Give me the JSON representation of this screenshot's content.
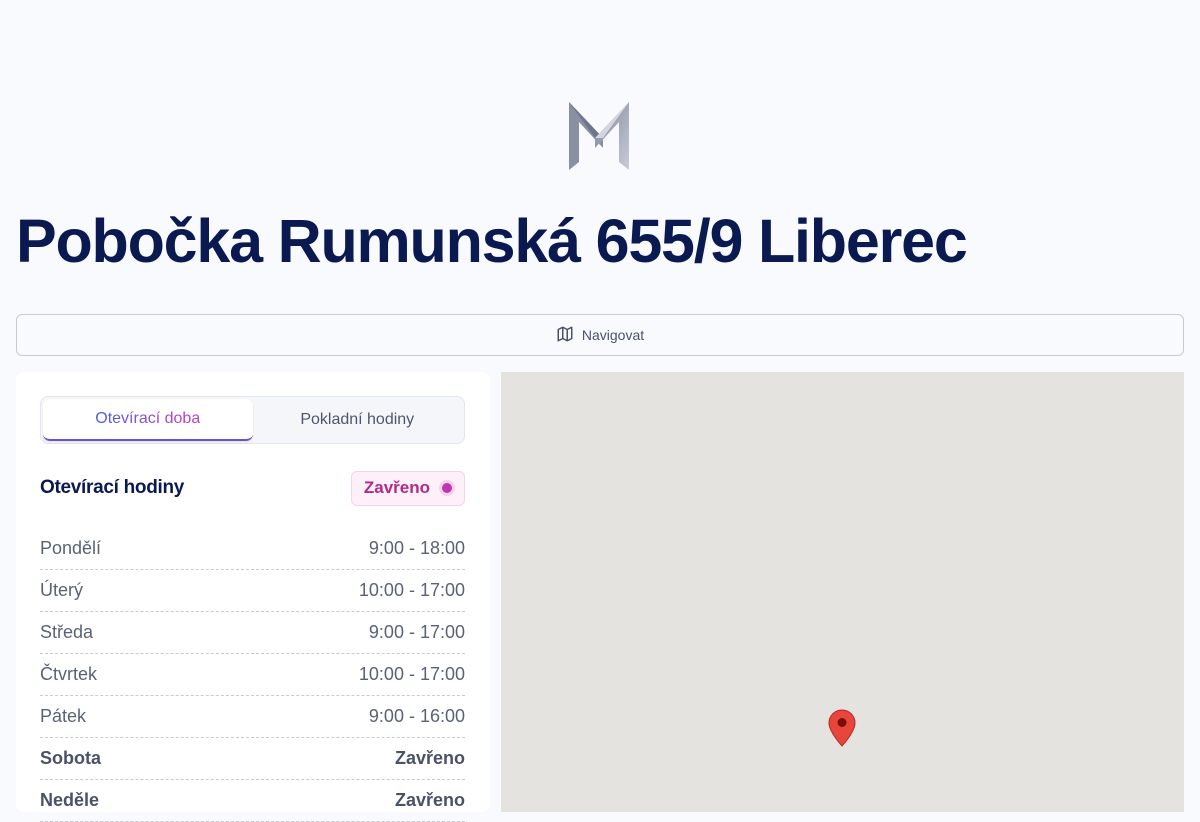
{
  "header": {
    "title": "Pobočka Rumunská 655/9 Liberec"
  },
  "navigate": {
    "label": "Navigovat",
    "icon": "map-icon"
  },
  "tabs": [
    {
      "label": "Otevírací doba",
      "active": true
    },
    {
      "label": "Pokladní hodiny",
      "active": false
    }
  ],
  "hours": {
    "title": "Otevírací hodiny",
    "status": "Zavřeno",
    "status_color": "#b02a8a",
    "rows": [
      {
        "day": "Pondělí",
        "time": "9:00 - 18:00"
      },
      {
        "day": "Úterý",
        "time": "10:00 - 17:00"
      },
      {
        "day": "Středa",
        "time": "9:00 - 17:00"
      },
      {
        "day": "Čtvrtek",
        "time": "10:00 - 17:00"
      },
      {
        "day": "Pátek",
        "time": "9:00 - 16:00"
      },
      {
        "day": "Sobota",
        "time": "Zavřeno"
      },
      {
        "day": "Neděle",
        "time": "Zavřeno"
      }
    ]
  },
  "map": {
    "marker_icon": "map-pin-icon",
    "marker_color": "#e8453c"
  }
}
